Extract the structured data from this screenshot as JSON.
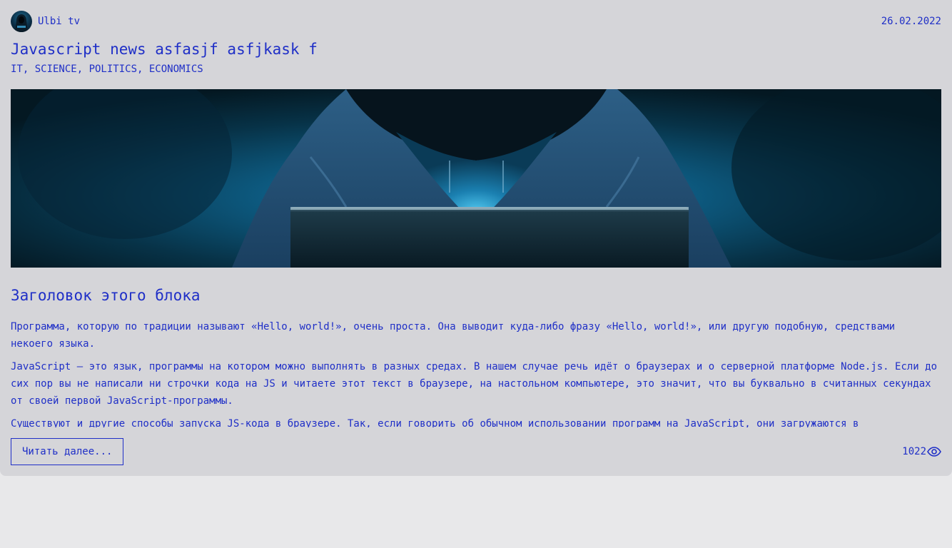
{
  "article": {
    "author": {
      "name": "Ulbi tv",
      "avatar_icon": "avatar-image"
    },
    "date": "26.02.2022",
    "title": "Javascript news asfasjf asfjkask f",
    "tags": "IT, SCIENCE, POLITICS, ECONOMICS",
    "image_icon": "hooded-hacker-laptop-image",
    "block": {
      "title": "Заголовок этого блока",
      "paragraphs": [
        "Программа, которую по традиции называют «Hello, world!», очень проста. Она выводит куда-либо фразу «Hello, world!», или другую подобную, средствами некоего языка.",
        "JavaScript — это язык, программы на котором можно выполнять в разных средах. В нашем случае речь идёт о браузерах и о серверной платформе Node.js. Если до сих пор вы не написали ни строчки кода на JS и читаете этот текст в браузере, на настольном компьютере, это значит, что вы буквально в считанных секундах от своей первой JavaScript-программы.",
        "Существуют и другие способы запуска JS-кода в браузере. Так, если говорить об обычном использовании программ на JavaScript, они загружаются в"
      ]
    },
    "read_more_label": "Читать далее...",
    "views": "1022",
    "views_icon": "eye-icon"
  },
  "colors": {
    "accent": "#1f2fc7",
    "card_bg": "#d5d5d9",
    "page_bg": "#e8e8ea"
  }
}
